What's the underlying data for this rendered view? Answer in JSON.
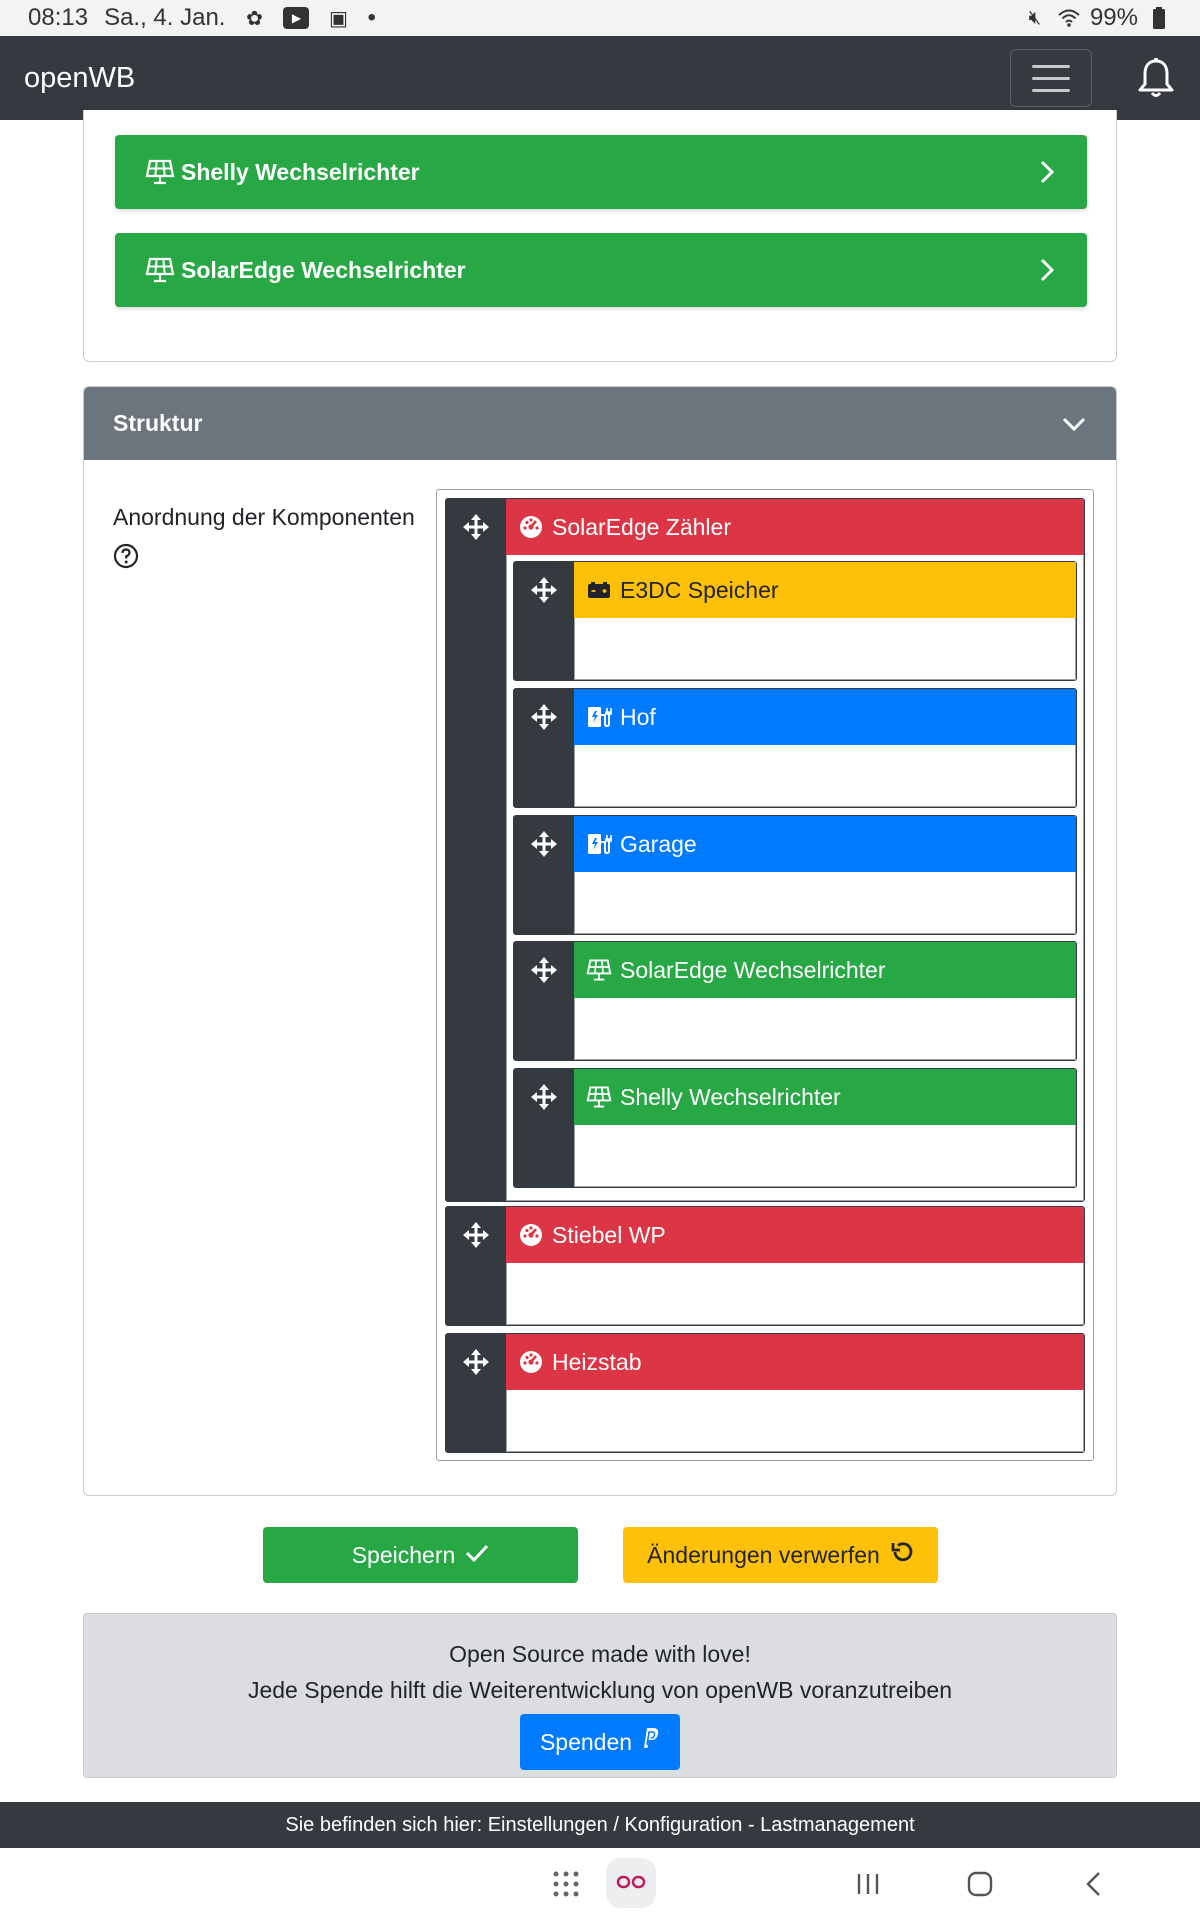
{
  "status_bar": {
    "time": "08:13",
    "date": "Sa., 4. Jan.",
    "dot": "•",
    "battery": "99%"
  },
  "navbar": {
    "brand": "openWB"
  },
  "top_list": [
    {
      "label": "Shelly Wechselrichter",
      "icon": "solar-panel-icon"
    },
    {
      "label": "SolarEdge Wechselrichter",
      "icon": "solar-panel-icon"
    }
  ],
  "struktur": {
    "title": "Struktur",
    "label": "Anordnung der Komponenten",
    "nodes": {
      "n0": {
        "label": "SolarEdge Zähler",
        "icon": "gauge-icon",
        "color": "#dc3545"
      },
      "n1": {
        "label": "E3DC Speicher",
        "icon": "battery-icon",
        "color": "#ffc107"
      },
      "n2": {
        "label": "Hof",
        "icon": "charging-station-icon",
        "color": "#007bff"
      },
      "n3": {
        "label": "Garage",
        "icon": "charging-station-icon",
        "color": "#007bff"
      },
      "n4": {
        "label": "SolarEdge Wechselrichter",
        "icon": "solar-panel-icon",
        "color": "#28a745"
      },
      "n5": {
        "label": "Shelly Wechselrichter",
        "icon": "solar-panel-icon",
        "color": "#28a745"
      },
      "n6": {
        "label": "Stiebel WP",
        "icon": "gauge-icon",
        "color": "#dc3545"
      },
      "n7": {
        "label": "Heizstab",
        "icon": "gauge-icon",
        "color": "#dc3545"
      }
    }
  },
  "actions": {
    "save": "Speichern",
    "discard": "Änderungen verwerfen"
  },
  "footer": {
    "line1": "Open Source made with love!",
    "line2": "Jede Spende hilft die Weiterentwicklung von openWB voranzutreiben",
    "donate": "Spenden"
  },
  "breadcrumb": "Sie befinden sich hier: Einstellungen / Konfiguration - Lastmanagement"
}
